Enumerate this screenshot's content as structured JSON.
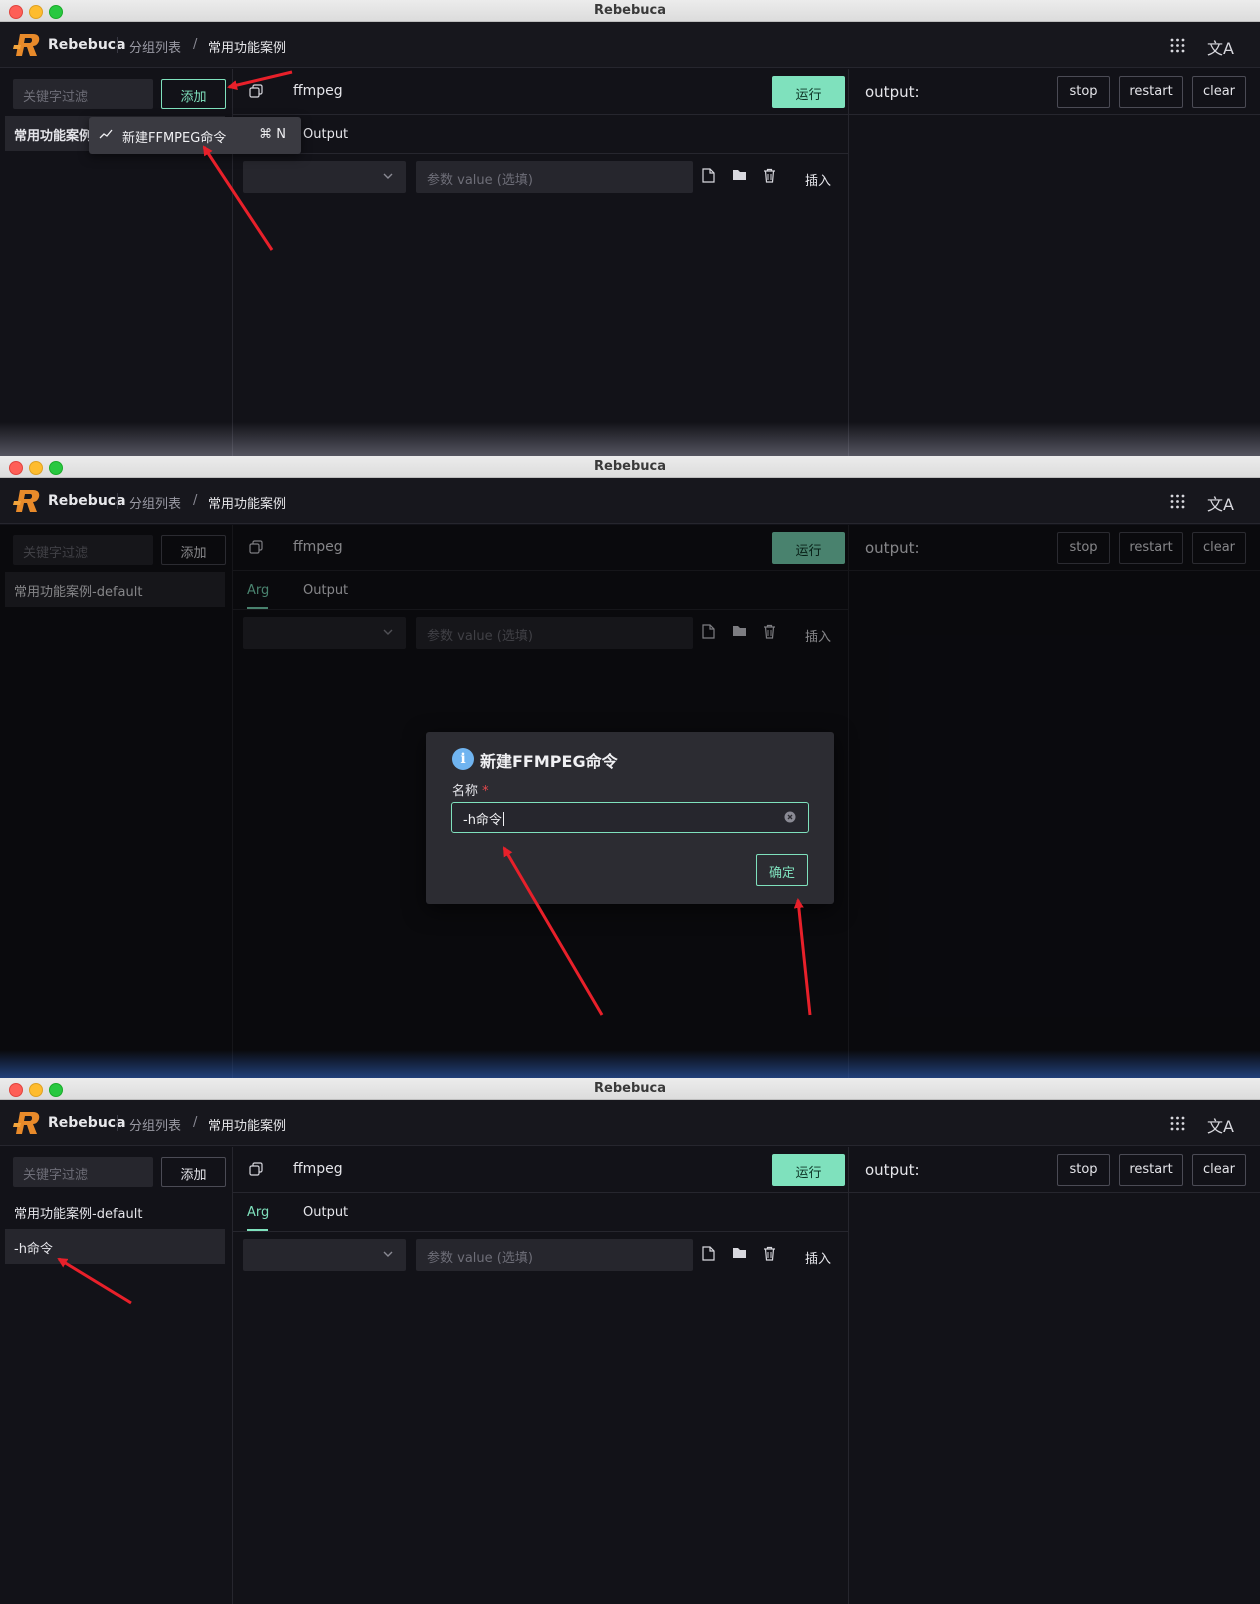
{
  "window": {
    "title": "Rebebuca"
  },
  "header": {
    "brand": "Rebebuca",
    "crumb_group_list": "分组列表",
    "crumb_sep": "/",
    "crumb_current": "常用功能案例"
  },
  "sidebar": {
    "filter_placeholder": "关键字过滤",
    "add_label": "添加",
    "items": [
      "常用功能案例-default",
      "-h命令"
    ],
    "item_truncated": "常用功能案例"
  },
  "dropdown": {
    "label": "新建FFMPEG命令",
    "shortcut": "⌘ N"
  },
  "command": {
    "name": "ffmpeg",
    "run_label": "运行"
  },
  "tabs": [
    "Arg",
    "Output"
  ],
  "args": {
    "value_placeholder": "参数 value (选填)",
    "insert_label": "插入"
  },
  "output": {
    "label": "output:",
    "stop": "stop",
    "restart": "restart",
    "clear": "clear"
  },
  "modal": {
    "title": "新建FFMPEG命令",
    "name_label": "名称",
    "required_mark": "*",
    "input_value": "-h命令",
    "ok_label": "确定"
  },
  "colors": {
    "accent": "#7fe1bd",
    "background": "#121218",
    "annotation_arrow": "#e8202a",
    "required": "#e5484d"
  },
  "icons": [
    "logo-icon",
    "apps-grid-icon",
    "translate-icon",
    "copy-icon",
    "chevron-down-icon",
    "file-icon",
    "folder-icon",
    "trash-icon",
    "chart-line-icon",
    "info-icon",
    "clear-circle-icon"
  ]
}
